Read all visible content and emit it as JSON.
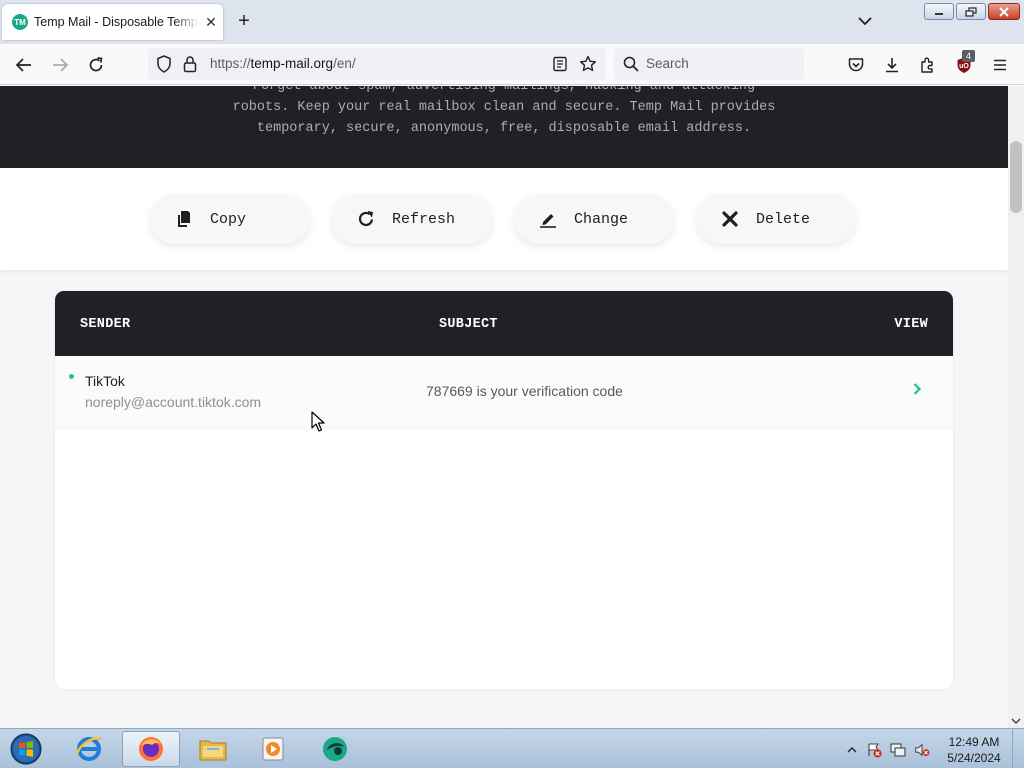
{
  "browser": {
    "tab_title": "Temp Mail - Disposable Temporary Email",
    "favicon_text": "TM",
    "url_scheme": "https://",
    "url_host": "temp-mail.org",
    "url_path": "/en/",
    "search_placeholder": "Search",
    "extension_badge": "4"
  },
  "page": {
    "hero_line1": "Forget about spam, advertising mailings, hacking and attacking",
    "hero_line2": "robots. Keep your real mailbox clean and secure. Temp Mail provides",
    "hero_line3": "temporary, secure, anonymous, free, disposable email address.",
    "actions": [
      {
        "label": "Copy",
        "icon": "copy-icon"
      },
      {
        "label": "Refresh",
        "icon": "refresh-icon"
      },
      {
        "label": "Change",
        "icon": "edit-icon"
      },
      {
        "label": "Delete",
        "icon": "delete-icon"
      }
    ],
    "inbox": {
      "headers": {
        "sender": "SENDER",
        "subject": "SUBJECT",
        "view": "VIEW"
      },
      "messages": [
        {
          "sender_name": "TikTok",
          "sender_email": "noreply@account.tiktok.com",
          "subject": "787669 is your verification code",
          "unread": true
        }
      ]
    }
  },
  "taskbar": {
    "items": [
      "internet-explorer",
      "firefox",
      "file-explorer",
      "media-player",
      "app"
    ],
    "clock_time": "12:49 AM",
    "clock_date": "5/24/2024"
  },
  "colors": {
    "accent": "#19c59a",
    "hero_bg": "#202124",
    "inbox_header_bg": "#1f2124"
  }
}
